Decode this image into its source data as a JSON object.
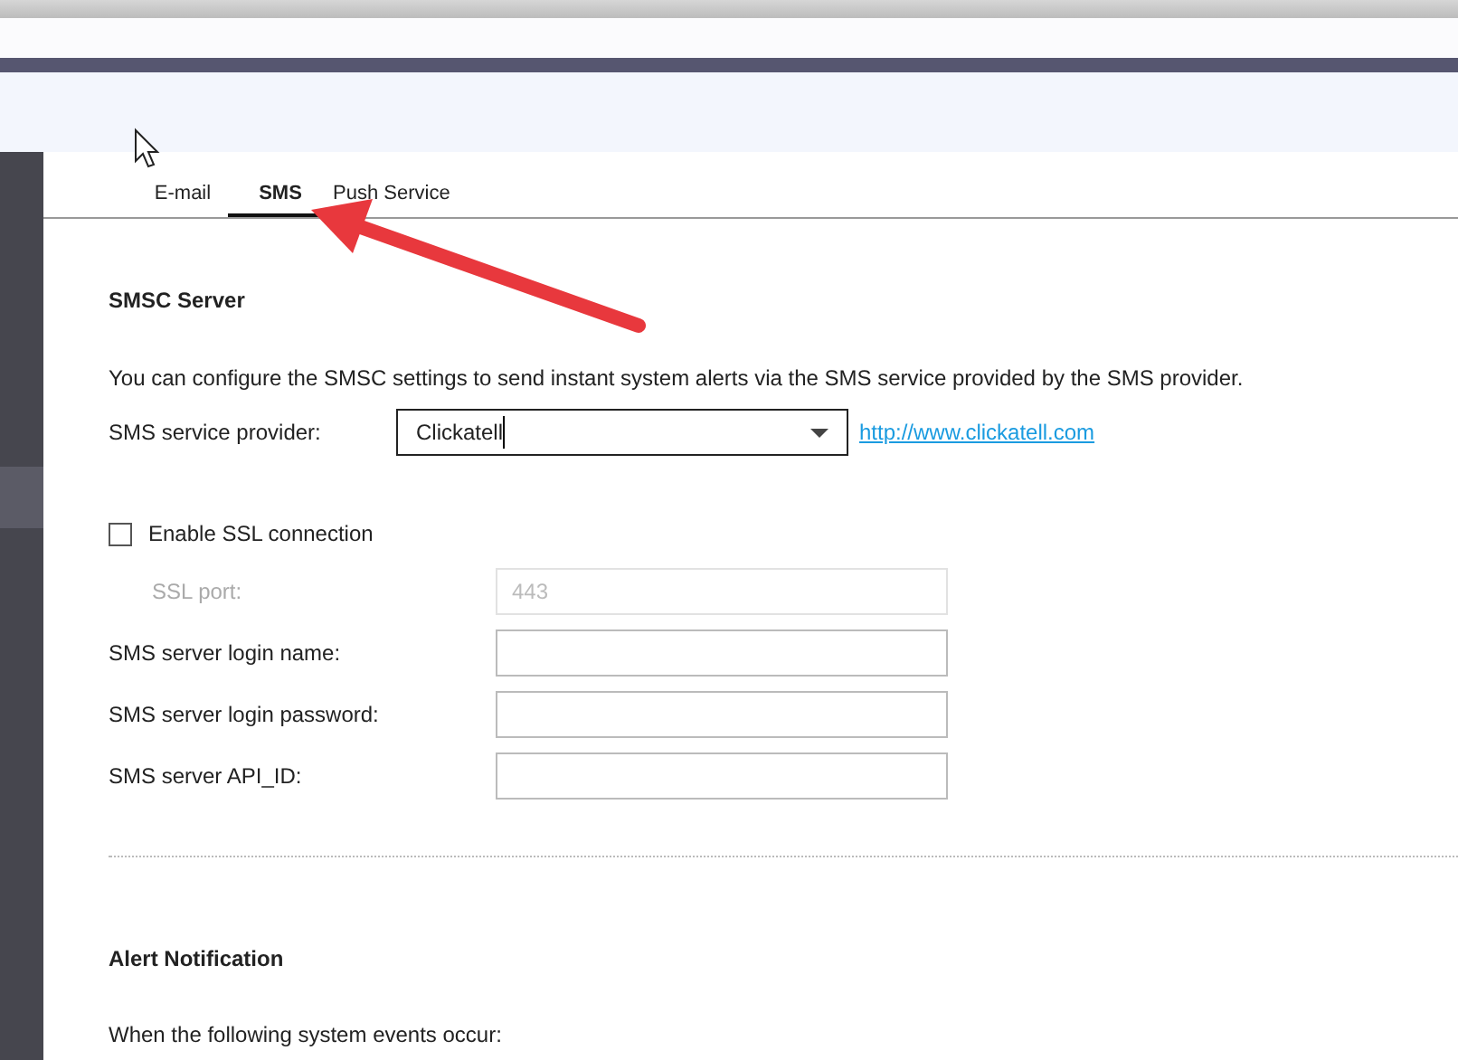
{
  "tabs": [
    {
      "label": "E-mail",
      "selected": false
    },
    {
      "label": "SMS",
      "selected": true
    },
    {
      "label": "Push Service",
      "selected": false
    }
  ],
  "smsc_server": {
    "title": "SMSC Server",
    "description": "You can configure the SMSC settings to send instant system alerts via the SMS service provided by the SMS provider.",
    "provider": {
      "label": "SMS service provider:",
      "value": "Clickatell",
      "link": "http://www.clickatell.com"
    },
    "ssl": {
      "label": "Enable SSL connection",
      "checked": false
    },
    "fields": [
      {
        "label": "SSL port:",
        "value": "443",
        "disabled": true
      },
      {
        "label": "SMS server login name:",
        "disabled": false
      },
      {
        "label": "SMS server login password:",
        "disabled": false
      },
      {
        "label": "SMS server API_ID:",
        "disabled": false
      }
    ]
  },
  "alert_notification": {
    "title": "Alert Notification",
    "text": "When the following system events occur:"
  }
}
